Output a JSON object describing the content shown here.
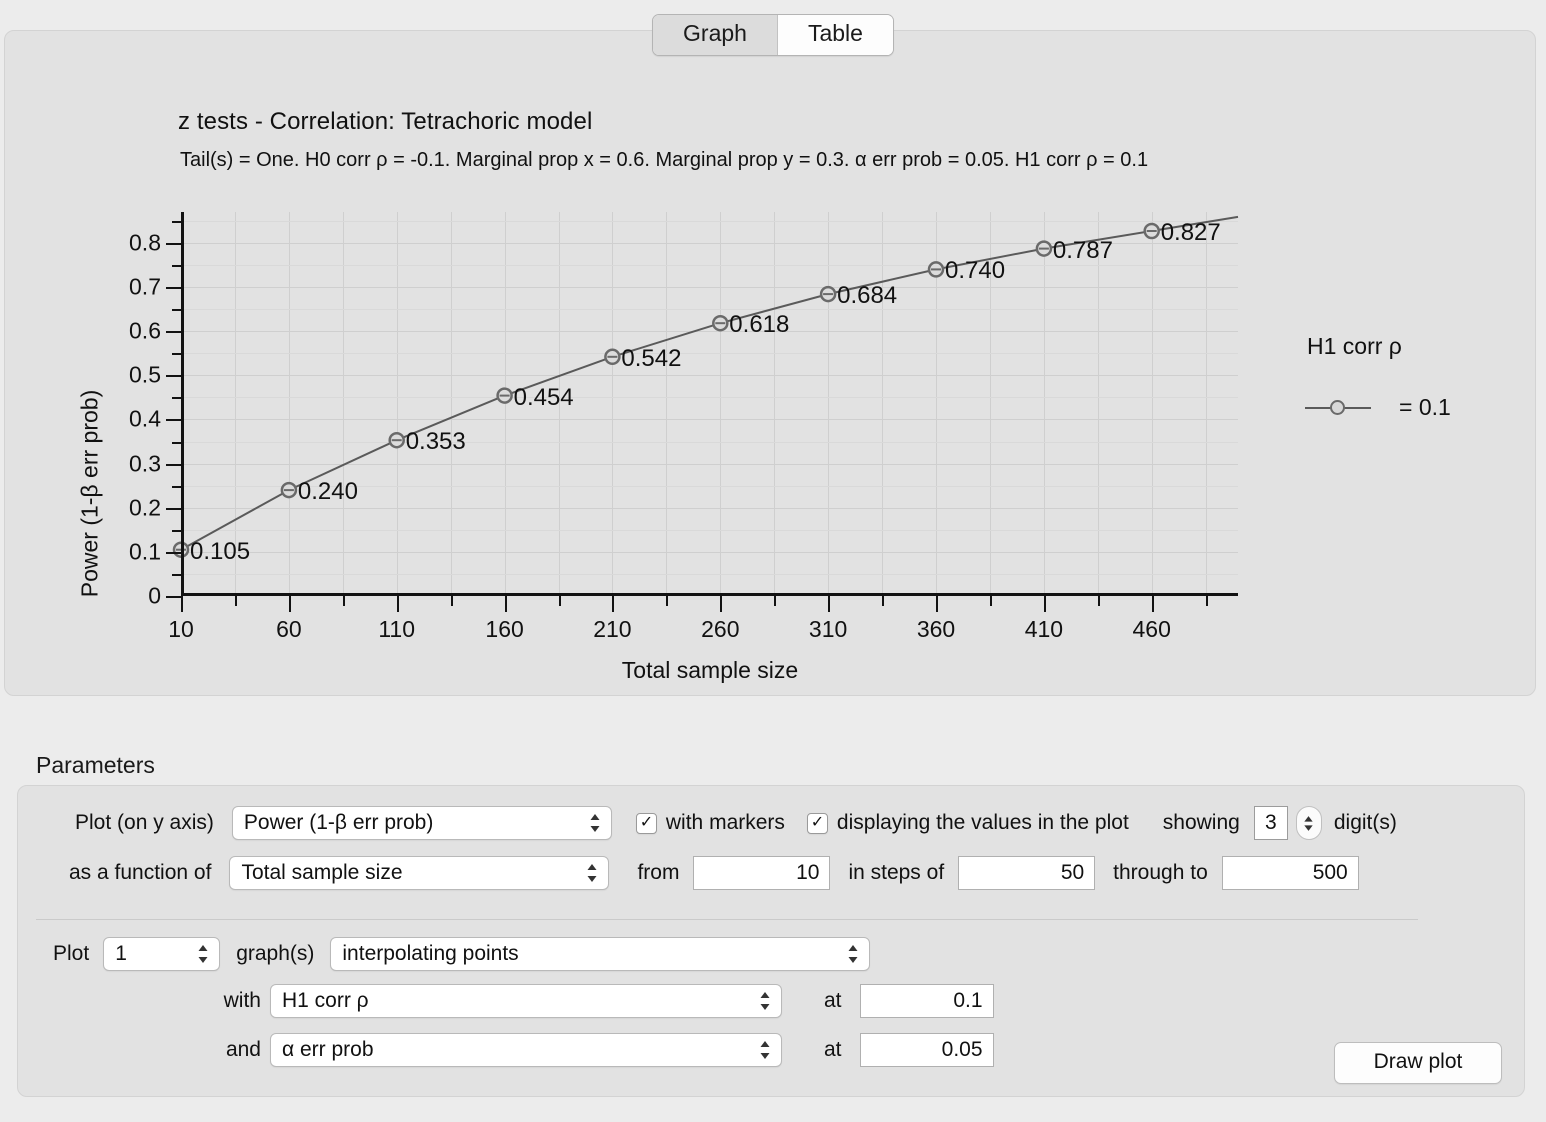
{
  "tabs": [
    {
      "label": "Graph",
      "active": true
    },
    {
      "label": "Table",
      "active": false
    }
  ],
  "chart_data": {
    "type": "line",
    "title": "z tests - Correlation: Tetrachoric model",
    "subtitle": "Tail(s) = One. H0 corr ρ = -0.1. Marginal prop x = 0.6. Marginal prop y = 0.3. α err prob = 0.05. H1 corr ρ = 0.1",
    "xlabel": "Total sample size",
    "ylabel": "Power (1-β err prob)",
    "x": [
      10,
      60,
      110,
      160,
      210,
      260,
      310,
      360,
      410,
      460
    ],
    "values": [
      0.105,
      0.24,
      0.353,
      0.454,
      0.542,
      0.618,
      0.684,
      0.74,
      0.787,
      0.827
    ],
    "point_labels": [
      "0.105",
      "0.240",
      "0.353",
      "0.454",
      "0.542",
      "0.618",
      "0.684",
      "0.740",
      "0.787",
      "0.827"
    ],
    "xticks": [
      "10",
      "60",
      "110",
      "160",
      "210",
      "260",
      "310",
      "360",
      "410",
      "460"
    ],
    "yticks": [
      "0",
      "0.1",
      "0.2",
      "0.3",
      "0.4",
      "0.5",
      "0.6",
      "0.7",
      "0.8"
    ],
    "xlim": [
      10,
      500
    ],
    "ylim": [
      0,
      0.87
    ],
    "grid": true,
    "legend_position": "right",
    "legend_title": "H1 corr ρ",
    "legend_entries": [
      "= 0.1"
    ],
    "series_color": "#5a5a5a",
    "marker": "circle-open"
  },
  "parameters": {
    "section_label": "Parameters",
    "row1": {
      "label": "Plot (on y axis)",
      "select_value": "Power (1-β err prob)",
      "markers_checkbox": {
        "label": "with markers",
        "checked": true,
        "check_glyph": "✓"
      },
      "values_checkbox": {
        "label": "displaying the values in the plot",
        "checked": true,
        "check_glyph": "✓"
      },
      "showing_label": "showing",
      "digits_value": "3",
      "digits_label": "digit(s)"
    },
    "row2": {
      "label": "as a function of",
      "select_value": "Total sample size",
      "from_label": "from",
      "from_value": "10",
      "steps_label": "in steps of",
      "steps_value": "50",
      "through_label": "through to",
      "through_value": "500"
    },
    "row3": {
      "plot_label": "Plot",
      "count_value": "1",
      "graphs_label": "graph(s)",
      "style_value": "interpolating points"
    },
    "row4": {
      "label": "with",
      "select_value": "H1 corr ρ",
      "at_label": "at",
      "at_value": "0.1"
    },
    "row5": {
      "label": "and",
      "select_value": "α err prob",
      "at_label": "at",
      "at_value": "0.05"
    },
    "draw_button": "Draw plot"
  }
}
